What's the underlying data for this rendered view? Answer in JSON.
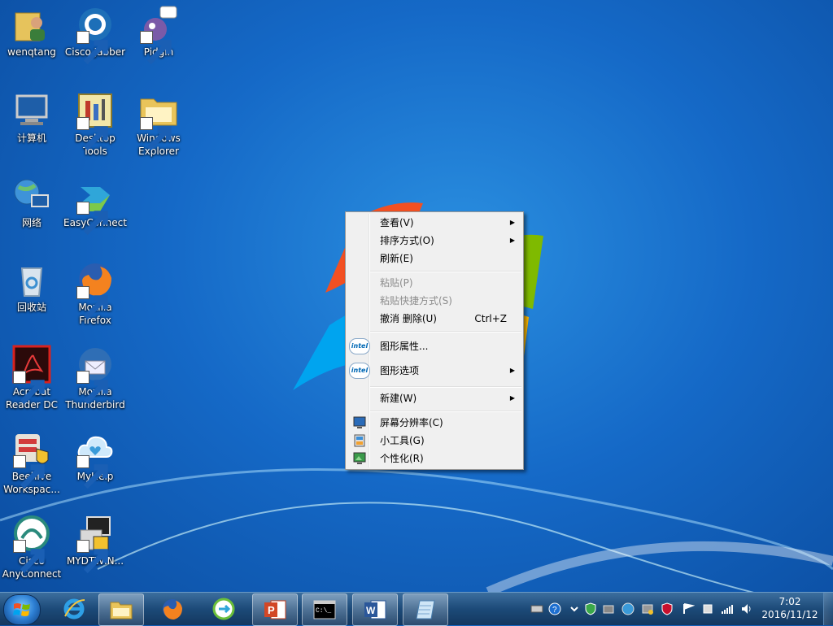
{
  "desktop": {
    "icons": [
      {
        "label": "wenqtang",
        "icon": "user-folder-icon"
      },
      {
        "label": "Cisco Jabber",
        "icon": "cisco-jabber-icon"
      },
      {
        "label": "Pidgin",
        "icon": "pidgin-icon"
      },
      {
        "label": "计算机",
        "icon": "computer-icon"
      },
      {
        "label": "Desktop Tools",
        "icon": "desktop-tools-icon"
      },
      {
        "label": "Windows Explorer",
        "icon": "windows-explorer-icon"
      },
      {
        "label": "网络",
        "icon": "network-icon"
      },
      {
        "label": "EasyConnect",
        "icon": "easyconnect-icon"
      },
      {
        "label": "回收站",
        "icon": "recycle-bin-icon"
      },
      {
        "label": "Mozilla Firefox",
        "icon": "firefox-icon"
      },
      {
        "label": "Acrobat Reader DC",
        "icon": "acrobat-reader-icon"
      },
      {
        "label": "Mozilla Thunderbird",
        "icon": "thunderbird-icon"
      },
      {
        "label": "Beehive Workspac...",
        "icon": "beehive-icon"
      },
      {
        "label": "MyHelp",
        "icon": "myhelp-icon"
      },
      {
        "label": "Cisco AnyConnect",
        "icon": "cisco-anyconnect-icon"
      },
      {
        "label": "MYDTWIN...",
        "icon": "mydtwin-icon"
      }
    ]
  },
  "context_menu": {
    "view": "查看(V)",
    "sort_by": "排序方式(O)",
    "refresh": "刷新(E)",
    "paste": "粘贴(P)",
    "paste_shortcut": "粘贴快捷方式(S)",
    "undo_delete": "撤消 删除(U)",
    "undo_shortcut": "Ctrl+Z",
    "graphics_properties": "图形属性...",
    "graphics_options": "图形选项",
    "new": "新建(W)",
    "screen_resolution": "屏幕分辨率(C)",
    "gadgets": "小工具(G)",
    "personalize": "个性化(R)",
    "intel_badge": "intel",
    "submenu_arrow": "▶"
  },
  "taskbar": {
    "pinned": [
      "internet-explorer-icon",
      "windows-explorer-icon",
      "firefox-icon",
      "easyconnect-icon",
      "powerpoint-icon",
      "command-prompt-icon",
      "word-icon",
      "notepad-icon"
    ],
    "clock": {
      "time": "7:02",
      "date": "2016/11/12"
    }
  },
  "colors": {
    "desktop_blue": "#1569c7",
    "taskbar": "#1c4a78",
    "menu_bg": "#f0f0f0"
  }
}
